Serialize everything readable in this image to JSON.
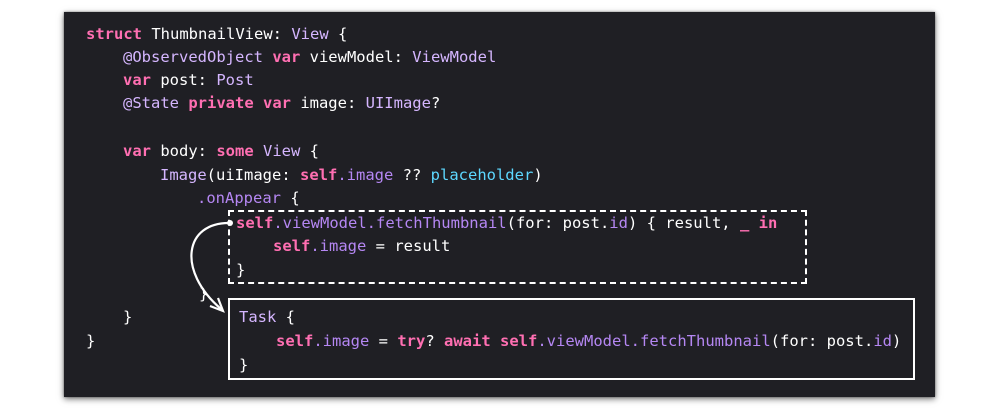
{
  "code": {
    "l1": {
      "kw_struct": "struct",
      "name": "ThumbnailView: ",
      "type_view": "View",
      "brace": " {"
    },
    "l2": {
      "attr": "@ObservedObject ",
      "kw_var": "var",
      "name": " viewModel: ",
      "type": "ViewModel"
    },
    "l3": {
      "kw_var": "var",
      "name": " post: ",
      "type": "Post"
    },
    "l4": {
      "attr": "@State ",
      "kw": "private var",
      "name": " image: ",
      "type": "UIImage",
      "suffix": "?"
    },
    "l6": {
      "kw_var": "var",
      "name": " body: ",
      "kw_some": "some",
      "type": " View",
      "brace": " {"
    },
    "l7": {
      "type": "Image",
      "paren": "(uiImage: ",
      "kw_self": "self",
      "dot_image": ".image",
      "coalesce": " ?? ",
      "placeholder": "placeholder",
      "close": ")"
    },
    "l8": {
      "method": ".onAppear",
      "brace": " {"
    },
    "l9": {
      "kw_self": "self",
      "chain": ".viewModel.",
      "fn": "fetchThumbnail",
      "args": "(for: post.",
      "id": "id",
      "rest": ") { result, ",
      "underscore": "_",
      "sp": " ",
      "kw_in": "in"
    },
    "l10": {
      "kw_self": "self",
      "dot_image": ".image",
      "rest": " = result"
    },
    "l11": {
      "brace": "}"
    },
    "l12": {
      "brace": "}"
    },
    "l13": {
      "brace": "}"
    },
    "l14": {
      "brace": "}"
    }
  },
  "replacement": {
    "l1": {
      "type": "Task",
      "brace": " {"
    },
    "l2": {
      "kw_self": "self",
      "dot_image": ".image",
      "eq": " = ",
      "kw_try": "try",
      "q": "? ",
      "kw_await": "await",
      "sp": " ",
      "kw_self2": "self",
      "chain": ".viewModel.",
      "fn": "fetchThumbnail",
      "args": "(for: post.",
      "id": "id",
      "close": ")"
    },
    "l3": {
      "brace": "}"
    }
  },
  "colors": {
    "background": "#1f1f24",
    "keyword": "#ff6fb2",
    "type": "#d5b6ff",
    "function": "#b587f3",
    "placeholder": "#5dd8ff",
    "text": "#ffffff"
  }
}
